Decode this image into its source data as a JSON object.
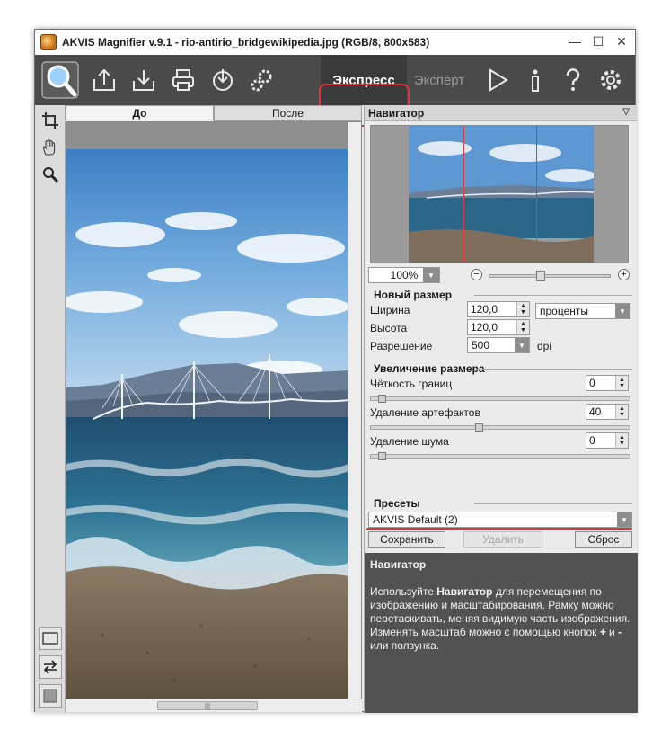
{
  "window": {
    "title": "AKVIS Magnifier v.9.1 - rio-antirio_bridgewikipedia.jpg (RGB/8, 800x583)",
    "controls": [
      "—",
      "☐",
      "✕"
    ]
  },
  "toolbar": {
    "icons": [
      "open-image-icon",
      "save-image-icon",
      "print-icon",
      "share-icon",
      "preferences-icon"
    ],
    "mode_express": "Экспресс",
    "mode_expert": "Эксперт",
    "right_icons": [
      "run-icon",
      "info-icon",
      "help-icon",
      "settings-icon"
    ],
    "highlight_color": "#e0343a"
  },
  "tools": {
    "crop": "crop-icon",
    "hand": "hand-icon",
    "zoom": "zoom-icon"
  },
  "tabs": {
    "before": "До",
    "after": "После"
  },
  "navigator": {
    "title": "Навигатор",
    "zoom_value": "100%",
    "zoom_minus": "−",
    "zoom_plus": "+"
  },
  "new_size": {
    "title": "Новый размер",
    "width_label": "Ширина",
    "width_value": "120,0",
    "height_label": "Высота",
    "height_value": "120,0",
    "unit": "проценты",
    "resolution_label": "Разрешение",
    "resolution_value": "500",
    "resolution_unit": "dpi"
  },
  "upscale": {
    "title": "Увеличение размера",
    "sharpness_label": "Чёткость границ",
    "sharpness_value": "0",
    "artifacts_label": "Удаление артефактов",
    "artifacts_value": "40",
    "noise_label": "Удаление шума",
    "noise_value": "0"
  },
  "presets": {
    "title": "Пресеты",
    "selected": "AKVIS Default (2)",
    "save_label": "Сохранить",
    "delete_label": "Удалить",
    "reset_label": "Сброс"
  },
  "help": {
    "title": "Навигатор",
    "text_1": "Используйте ",
    "text_bold": "Навигатор",
    "text_2": " для перемещения по изображению и масштабирования. Рамку можно перетаскивать, меняя видимую часть изображения. Изменять масштаб можно с помощью кнопок ",
    "plus": "+",
    "text_3": " и ",
    "minus": "-",
    "text_4": " или ползунка."
  },
  "scroll": {
    "grip": "|||"
  }
}
